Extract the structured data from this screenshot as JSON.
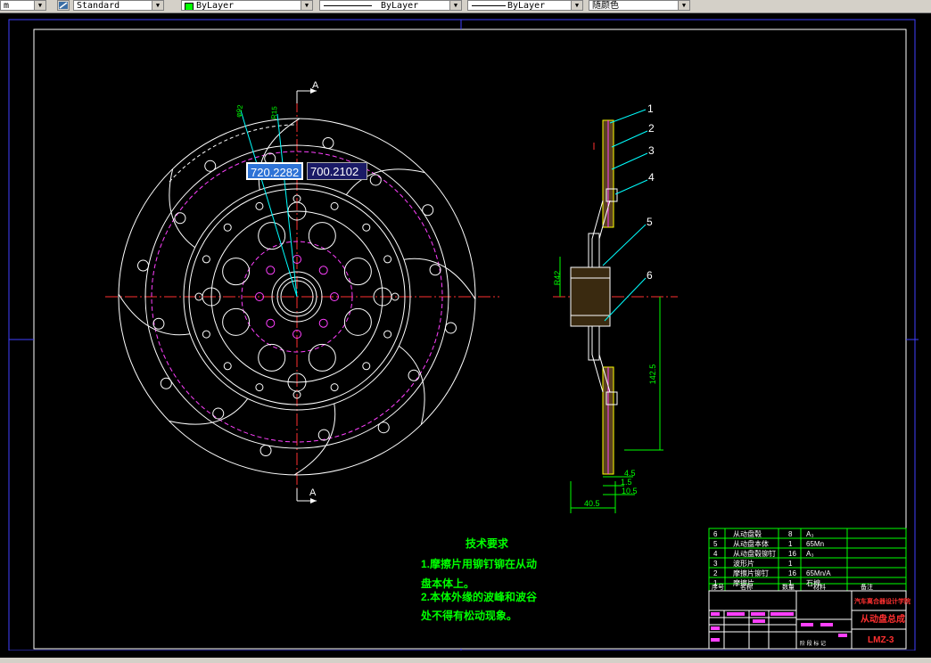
{
  "toolbar": {
    "unit_fragment": "m",
    "text_style": "Standard",
    "layer_color": "ByLayer",
    "linetype": "ByLayer",
    "lineweight": "ByLayer",
    "plot_style": "随颜色"
  },
  "dynamic_input": {
    "x": "720.2282",
    "y": "700.2102"
  },
  "section_mark": "A",
  "dimensions": {
    "d_top_1": "φ92",
    "d_top_2": "R15",
    "r42": "R42",
    "h1425": "142.5",
    "d45": "4.5",
    "d15": "1.5",
    "d105": "10.5",
    "d405": "40.5"
  },
  "balloons": [
    "1",
    "2",
    "3",
    "4",
    "5",
    "6"
  ],
  "tech_requirements": {
    "title": "技术要求",
    "lines": [
      "1.摩擦片用铆钉铆在从动",
      "盘本体上。",
      "2.本体外缘的波峰和波谷",
      "处不得有松动现象。"
    ]
  },
  "parts_table": {
    "rows": [
      [
        "6",
        "从动盘毂",
        "8",
        "A₃"
      ],
      [
        "5",
        "从动盘本体",
        "1",
        "65Mn"
      ],
      [
        "4",
        "从动盘毂铆钉",
        "16",
        "A₃"
      ],
      [
        "3",
        "波形片",
        "1",
        ""
      ],
      [
        "2",
        "摩擦片铆钉",
        "16",
        "65Mn/A"
      ],
      [
        "1",
        "摩擦片",
        "1",
        "石棉"
      ]
    ],
    "header": [
      "序号",
      "名称",
      "数量",
      "材料",
      "备注"
    ]
  },
  "title_block": {
    "school": "汽车离合器设计学院",
    "drawing_name": "从动盘总成",
    "drawing_no": "LMZ-3"
  }
}
